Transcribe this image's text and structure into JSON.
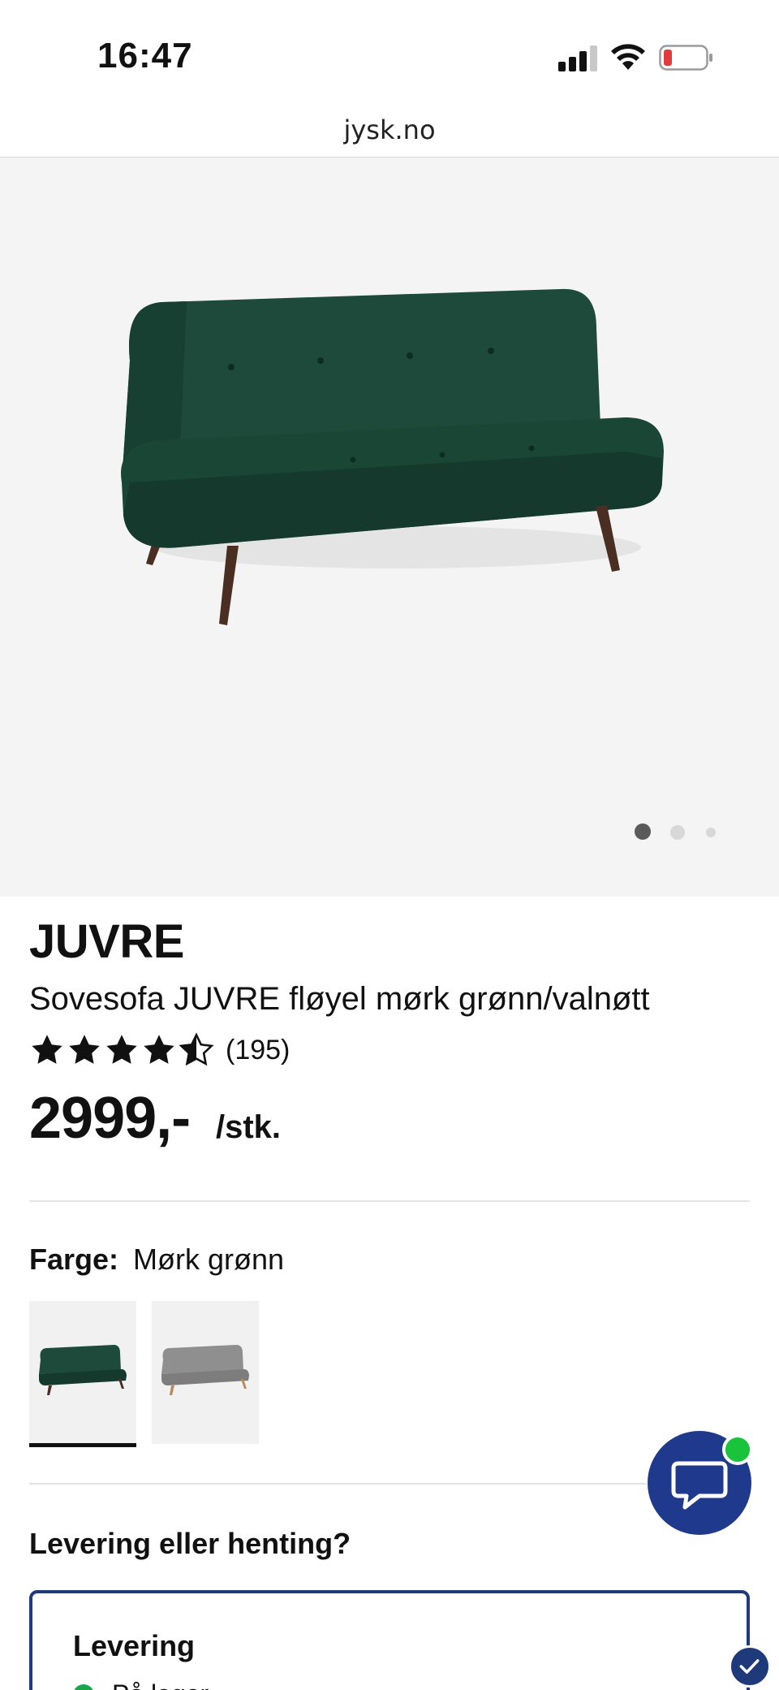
{
  "status_bar": {
    "time": "16:47",
    "icons": [
      "cellular-signal-icon",
      "wifi-icon",
      "battery-low-icon"
    ]
  },
  "browser": {
    "url": "jysk.no"
  },
  "gallery": {
    "image_alt": "Sovesofa JUVRE fløyel mørk grønn/valnøtt",
    "slides": 3,
    "active_slide": 1
  },
  "product": {
    "brand": "JUVRE",
    "name": "Sovesofa JUVRE fløyel mørk grønn/valnøtt",
    "rating": 4.5,
    "rating_max": 5,
    "review_count": "(195)",
    "price": "2999,-",
    "unit": "/stk."
  },
  "color": {
    "label": "Farge:",
    "value": "Mørk grønn",
    "options": [
      {
        "name": "Mørk grønn",
        "selected": true
      },
      {
        "name": "Grå",
        "selected": false
      }
    ]
  },
  "delivery": {
    "title": "Levering eller henting?",
    "card_title": "Levering",
    "stock_status": "På lager"
  },
  "colors": {
    "brand_blue": "#1f3a8c",
    "online_green": "#19c33c",
    "stock_green": "#19a64a",
    "sofa_green": "#1f4f3e"
  }
}
